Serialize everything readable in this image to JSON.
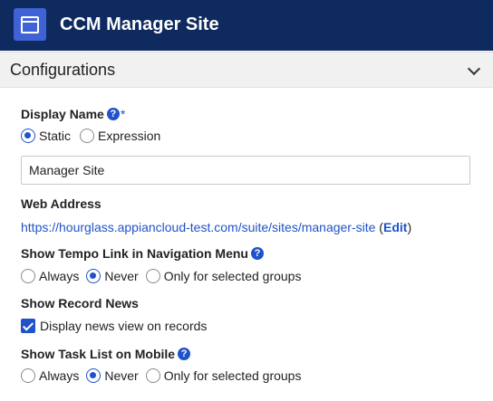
{
  "header": {
    "title": "CCM Manager Site"
  },
  "section": {
    "title": "Configurations"
  },
  "display_name": {
    "label": "Display Name",
    "help": "?",
    "required_mark": "*",
    "options": [
      "Static",
      "Expression"
    ],
    "selected": "Static",
    "value": "Manager Site"
  },
  "web_address": {
    "label": "Web Address",
    "url": "https://hourglass.appiancloud-test.com/suite/sites/manager-site",
    "open_paren": " (",
    "edit_label": "Edit",
    "close_paren": ")"
  },
  "tempo_link": {
    "label": "Show Tempo Link in Navigation Menu",
    "help": "?",
    "options": [
      "Always",
      "Never",
      "Only for selected groups"
    ],
    "selected": "Never"
  },
  "record_news": {
    "label": "Show Record News",
    "checkbox_label": "Display news view on records",
    "checked": true
  },
  "task_list": {
    "label": "Show Task List on Mobile",
    "help": "?",
    "options": [
      "Always",
      "Never",
      "Only for selected groups"
    ],
    "selected": "Never"
  },
  "colors": {
    "header_bg": "#0e2a5e",
    "accent": "#2053c9",
    "icon_bg": "#3f63d6"
  },
  "icons": {
    "app": "window-icon",
    "collapse": "chevron-down-icon",
    "help": "help-circle-icon"
  }
}
